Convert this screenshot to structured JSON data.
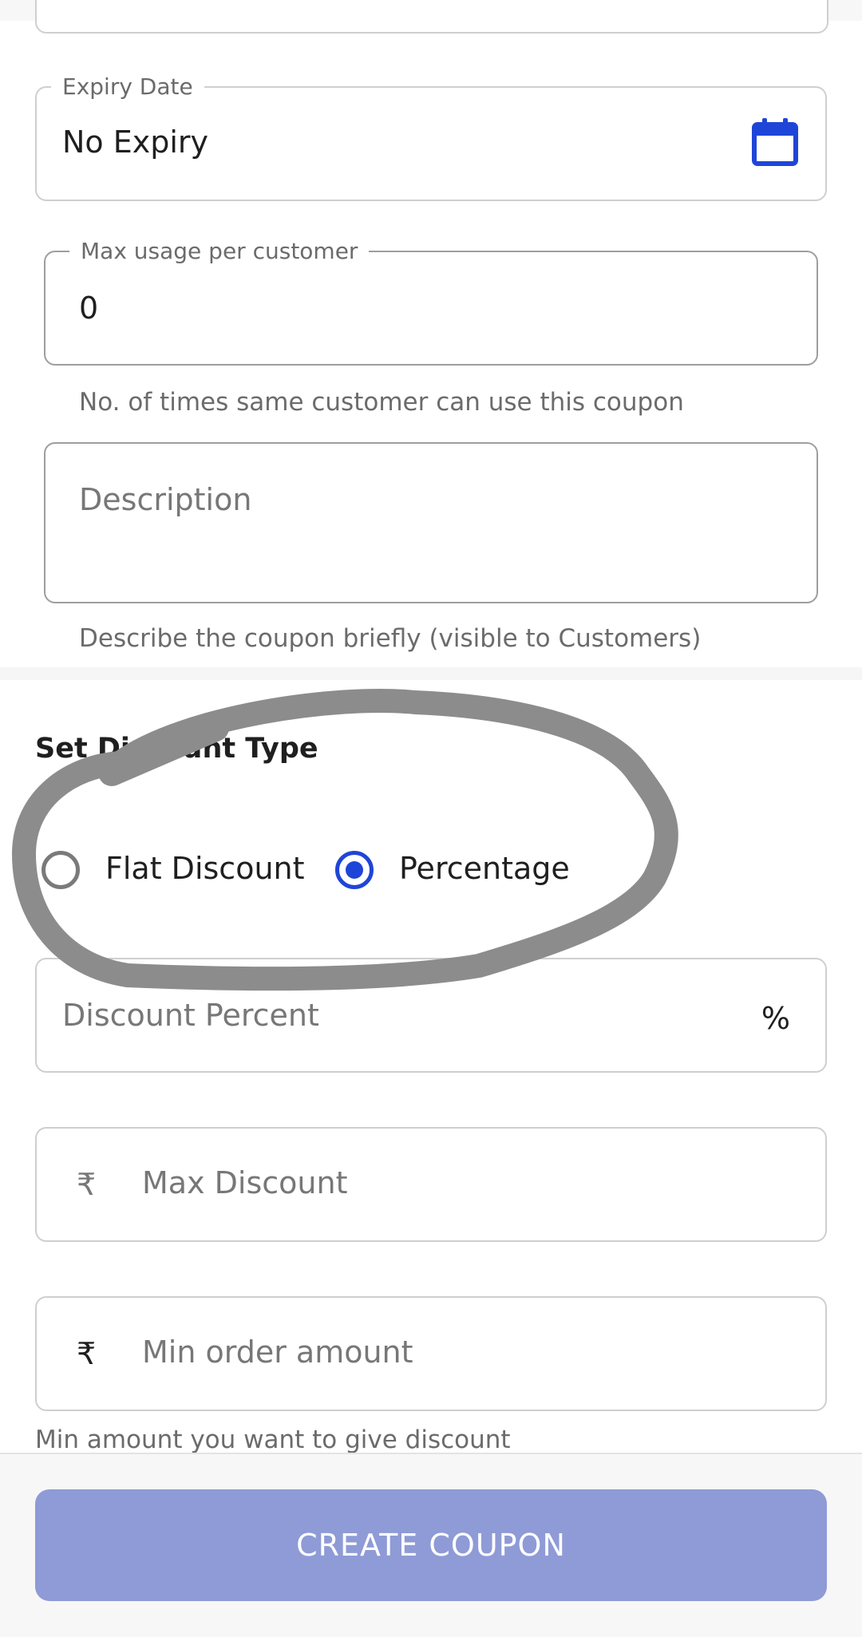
{
  "expiry": {
    "label": "Expiry Date",
    "value": "No Expiry",
    "icon": "calendar-icon"
  },
  "max_usage": {
    "label": "Max usage per customer",
    "value": "0",
    "helper": "No. of times same customer can use this coupon"
  },
  "description": {
    "placeholder": "Description",
    "helper": "Describe the coupon briefly (visible to Customers)"
  },
  "discount_type": {
    "title": "Set Discount Type",
    "options": [
      {
        "label": "Flat Discount",
        "selected": false
      },
      {
        "label": "Percentage",
        "selected": true
      }
    ]
  },
  "discount_percent": {
    "placeholder": "Discount Percent",
    "suffix": "%"
  },
  "max_discount": {
    "prefix": "₹",
    "placeholder": "Max Discount"
  },
  "min_order": {
    "prefix": "₹",
    "placeholder": "Min order amount",
    "helper": "Min amount you want to give discount"
  },
  "cta": {
    "label": "CREATE COUPON"
  },
  "colors": {
    "accent": "#1f45d8",
    "cta_bg": "#8f9bd6",
    "annotation": "#8c8c8c"
  }
}
